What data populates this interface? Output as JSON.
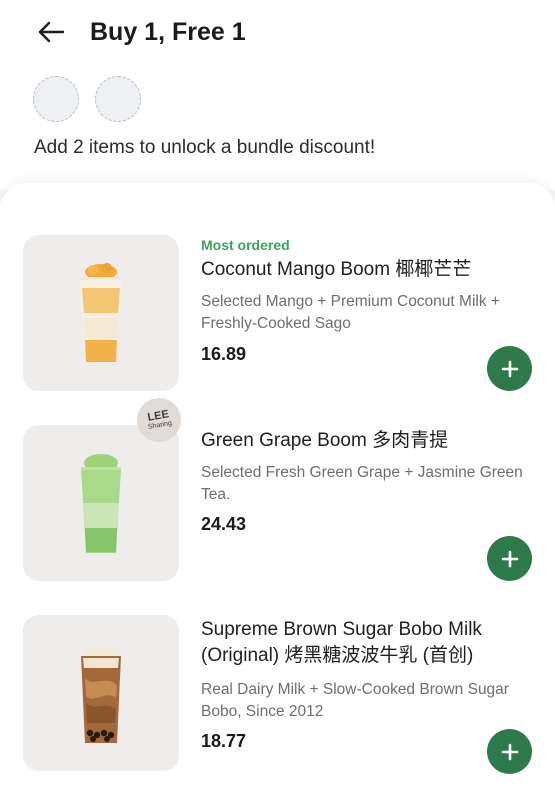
{
  "header": {
    "title": "Buy 1, Free 1",
    "back_icon": "arrow-left-icon",
    "hint": "Add 2 items to unlock a bundle discount!"
  },
  "sharing_badge": {
    "main": "LEE",
    "sub": "Sharing"
  },
  "colors": {
    "accent_green": "#2f7a4a",
    "most_ordered_green": "#3aa55a"
  },
  "items": [
    {
      "badge": "Most ordered",
      "name": "Coconut Mango Boom 椰椰芒芒",
      "description": "Selected Mango + Premium Coconut Milk + Freshly-Cooked Sago",
      "price": "16.89",
      "icon": "plus-icon"
    },
    {
      "badge": "",
      "name": "Green Grape Boom 多肉青提",
      "description": "Selected Fresh Green Grape + Jasmine Green Tea.",
      "price": "24.43",
      "icon": "plus-icon"
    },
    {
      "badge": "",
      "name": "Supreme Brown Sugar Bobo Milk (Original) 烤黑糖波波牛乳 (首创)",
      "description": "Real Dairy Milk + Slow-Cooked Brown Sugar Bobo,  Since 2012",
      "price": "18.77",
      "icon": "plus-icon"
    }
  ]
}
